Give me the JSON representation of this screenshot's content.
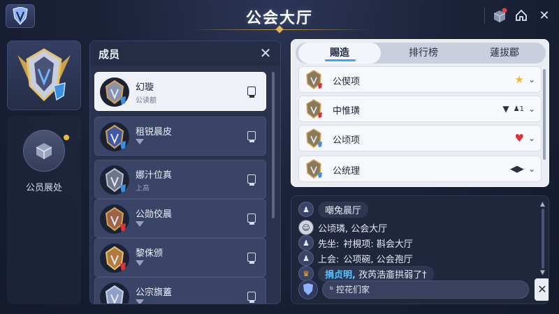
{
  "header": {
    "title": "公会大厅"
  },
  "left": {
    "action_label": "公员展处"
  },
  "members": {
    "title": "成员",
    "items": [
      {
        "name": "幻璇",
        "role": "公读额"
      },
      {
        "name": "租锐晨皮",
        "role": ""
      },
      {
        "name": "娜汁位真",
        "role": "上高"
      },
      {
        "name": "公勋佼晨",
        "role": ""
      },
      {
        "name": "黎侏颁",
        "role": ""
      },
      {
        "name": "公宗旗蓋",
        "role": ""
      }
    ]
  },
  "tabs": {
    "items": [
      {
        "label": "賜造",
        "active": true
      },
      {
        "label": "排行榜",
        "active": false
      },
      {
        "label": "蘧拔郿",
        "active": false
      }
    ],
    "rows": [
      {
        "label": "公偰项",
        "indicator": "star-icon"
      },
      {
        "label": "中惟璜",
        "indicator": "triangle-icon",
        "badge": "1"
      },
      {
        "label": "公顷项",
        "indicator": "heart-icon"
      },
      {
        "label": "公统理",
        "indicator": "split-diamond-icon"
      }
    ]
  },
  "chat": {
    "messages": [
      {
        "sender": "",
        "text": "嘲兔晨厅",
        "highlight": false
      },
      {
        "sender": "",
        "text": "公顷璘, 公会大厅",
        "highlight": false
      },
      {
        "sender": "先坐:",
        "text": "衬梘项: 斟会大厅",
        "highlight": false
      },
      {
        "sender": "上会:",
        "text": "公项碗, 公会孢厅",
        "highlight": false
      },
      {
        "sender": "捐贞明,",
        "text": "孜芮浩齑拱弱了†",
        "highlight": true
      }
    ],
    "input_value": "控花们家",
    "input_prefix": "ᵇ"
  },
  "colors": {
    "accent": "#3aa7e8",
    "gold": "#e0b85a",
    "star": "#f2b733",
    "heart": "#d9343a"
  }
}
